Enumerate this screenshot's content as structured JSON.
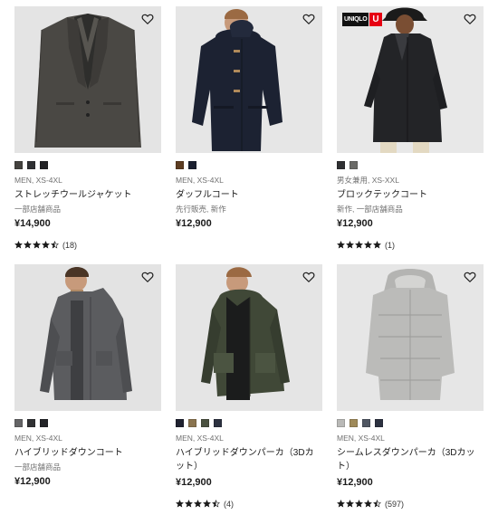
{
  "products": [
    {
      "swatches": [
        "#44423f",
        "#2f3033",
        "#222325"
      ],
      "meta": "MEN, XS-4XL",
      "name": "ストレッチウールジャケット",
      "note": "一部店舗商品",
      "price": "¥14,900",
      "rating": 4.5,
      "count": "(18)"
    },
    {
      "swatches": [
        "#5d3d22",
        "#1b2030"
      ],
      "meta": "MEN, XS-4XL",
      "name": "ダッフルコート",
      "note": "先行販売, 新作",
      "price": "¥12,900"
    },
    {
      "badge": [
        "UNIQLO",
        "U"
      ],
      "swatches": [
        "#2f3032",
        "#6b6b68"
      ],
      "meta": "男女兼用, XS-XXL",
      "name": "ブロックテックコート",
      "note": "新作, 一部店舗商品",
      "price": "¥12,900",
      "rating": 5,
      "count": "(1)"
    },
    {
      "swatches": [
        "#646466",
        "#303133",
        "#232428"
      ],
      "meta": "MEN, XS-4XL",
      "name": "ハイブリッドダウンコート",
      "note": "一部店舗商品",
      "price": "¥12,900"
    },
    {
      "swatches": [
        "#1f2230",
        "#8a744f",
        "#4a5140",
        "#2c3140"
      ],
      "meta": "MEN, XS-4XL",
      "name": "ハイブリッドダウンパーカ（3Dカット）",
      "note": "",
      "price": "¥12,900",
      "rating": 4.5,
      "count": "(4)"
    },
    {
      "swatches": [
        "#b9b9b7",
        "#9f8a5a",
        "#4f5662",
        "#2c3140"
      ],
      "meta": "MEN, XS-4XL",
      "name": "シームレスダウンパーカ（3Dカット）",
      "note": "",
      "price": "¥12,900",
      "rating": 4.5,
      "count": "(597)"
    }
  ]
}
